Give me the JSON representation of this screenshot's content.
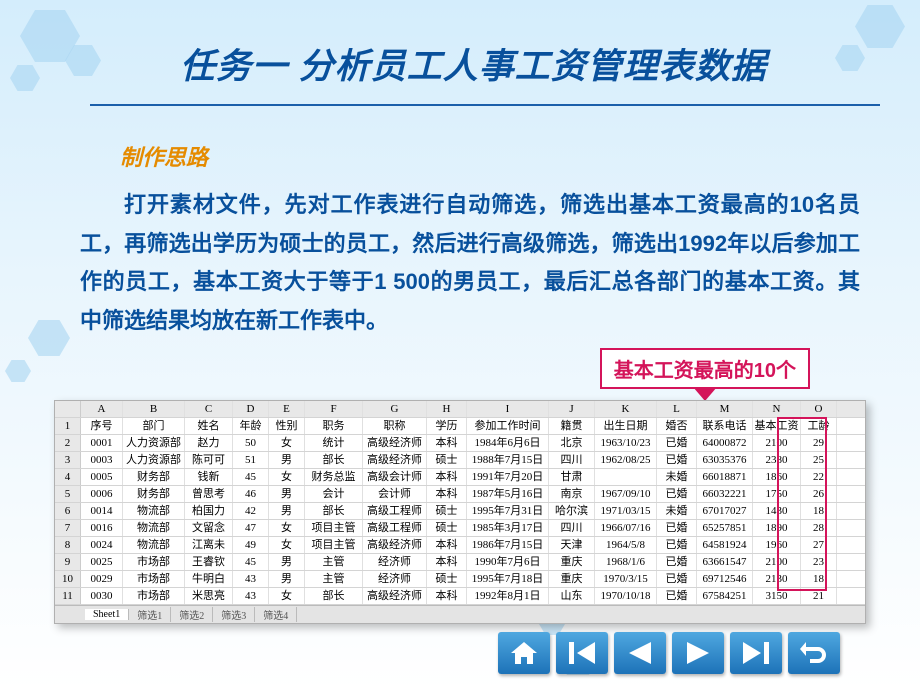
{
  "title": "任务一  分析员工人事工资管理表数据",
  "subtitle": "制作思路",
  "body": "打开素材文件，先对工作表进行自动筛选，筛选出基本工资最高的10名员工，再筛选出学历为硕士的员工，然后进行高级筛选，筛选出1992年以后参加工作的员工，基本工资大于等于1 500的男员工，最后汇总各部门的基本工资。其中筛选结果均放在新工作表中。",
  "callout": "基本工资最高的10个",
  "columns": {
    "letters": [
      "A",
      "B",
      "C",
      "D",
      "E",
      "F",
      "G",
      "H",
      "I",
      "J",
      "K",
      "L",
      "M",
      "N",
      "O"
    ],
    "headers": [
      "序号",
      "部门",
      "姓名",
      "年龄",
      "性别",
      "职务",
      "职称",
      "学历",
      "参加工作时间",
      "籍贯",
      "出生日期",
      "婚否",
      "联系电话",
      "基本工资",
      "工龄"
    ]
  },
  "rows": [
    {
      "n": "2",
      "d": [
        "0001",
        "人力资源部",
        "赵力",
        "50",
        "女",
        "统计",
        "高级经济师",
        "本科",
        "1984年6月6日",
        "北京",
        "1963/10/23",
        "已婚",
        "64000872",
        "2100",
        "29"
      ]
    },
    {
      "n": "3",
      "d": [
        "0003",
        "人力资源部",
        "陈可可",
        "51",
        "男",
        "部长",
        "高级经济师",
        "硕士",
        "1988年7月15日",
        "四川",
        "1962/08/25",
        "已婚",
        "63035376",
        "2380",
        "25"
      ]
    },
    {
      "n": "4",
      "d": [
        "0005",
        "财务部",
        "钱新",
        "45",
        "女",
        "财务总监",
        "高级会计师",
        "本科",
        "1991年7月20日",
        "甘肃",
        "",
        "未婚",
        "66018871",
        "1860",
        "22"
      ]
    },
    {
      "n": "5",
      "d": [
        "0006",
        "财务部",
        "曾思考",
        "46",
        "男",
        "会计",
        "会计师",
        "本科",
        "1987年5月16日",
        "南京",
        "1967/09/10",
        "已婚",
        "66032221",
        "1750",
        "26"
      ]
    },
    {
      "n": "6",
      "d": [
        "0014",
        "物流部",
        "柏国力",
        "42",
        "男",
        "部长",
        "高级工程师",
        "硕士",
        "1995年7月31日",
        "哈尔滨",
        "1971/03/15",
        "未婚",
        "67017027",
        "1430",
        "18"
      ]
    },
    {
      "n": "7",
      "d": [
        "0016",
        "物流部",
        "文留念",
        "47",
        "女",
        "项目主管",
        "高级工程师",
        "硕士",
        "1985年3月17日",
        "四川",
        "1966/07/16",
        "已婚",
        "65257851",
        "1890",
        "28"
      ]
    },
    {
      "n": "8",
      "d": [
        "0024",
        "物流部",
        "江离未",
        "49",
        "女",
        "项目主管",
        "高级经济师",
        "本科",
        "1986年7月15日",
        "天津",
        "1964/5/8",
        "已婚",
        "64581924",
        "1960",
        "27"
      ]
    },
    {
      "n": "9",
      "d": [
        "0025",
        "市场部",
        "王睿钦",
        "45",
        "男",
        "主管",
        "经济师",
        "本科",
        "1990年7月6日",
        "重庆",
        "1968/1/6",
        "已婚",
        "63661547",
        "2100",
        "23"
      ]
    },
    {
      "n": "10",
      "d": [
        "0029",
        "市场部",
        "牛明白",
        "43",
        "男",
        "主管",
        "经济师",
        "硕士",
        "1995年7月18日",
        "重庆",
        "1970/3/15",
        "已婚",
        "69712546",
        "2130",
        "18"
      ]
    },
    {
      "n": "11",
      "d": [
        "0030",
        "市场部",
        "米思亮",
        "43",
        "女",
        "部长",
        "高级经济师",
        "本科",
        "1992年8月1日",
        "山东",
        "1970/10/18",
        "已婚",
        "67584251",
        "3150",
        "21"
      ]
    }
  ],
  "tabs": [
    "Sheet1",
    "筛选1",
    "筛选2",
    "筛选3",
    "筛选4"
  ],
  "nav": {
    "home": "home-icon",
    "first": "first-icon",
    "prev": "prev-icon",
    "next": "next-icon",
    "last": "last-icon",
    "return": "return-icon"
  }
}
